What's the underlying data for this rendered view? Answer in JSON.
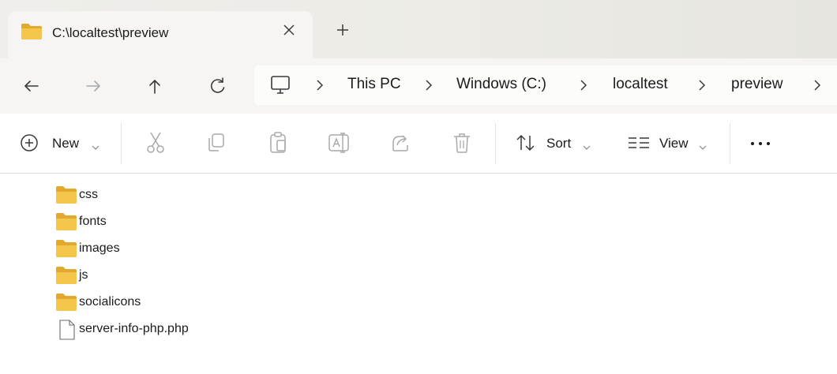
{
  "window": {
    "tab_title": "C:\\localtest\\preview",
    "tab_icon": "folder-icon",
    "close_icon": "close-icon",
    "new_tab_icon": "plus-icon"
  },
  "navigation": {
    "back_icon": "arrow-left-icon",
    "forward_icon": "arrow-right-icon",
    "up_icon": "arrow-up-icon",
    "refresh_icon": "refresh-icon"
  },
  "address_bar": {
    "root_icon": "this-pc-icon",
    "breadcrumbs": [
      "This PC",
      "Windows (C:)",
      "localtest",
      "preview"
    ]
  },
  "toolbar": {
    "new_label": "New",
    "sort_label": "Sort",
    "view_label": "View",
    "icons": [
      "cut-icon",
      "copy-icon",
      "paste-icon",
      "rename-icon",
      "share-icon",
      "delete-icon"
    ],
    "more_icon": "more-icon"
  },
  "files": [
    {
      "name": "css",
      "type": "folder"
    },
    {
      "name": "fonts",
      "type": "folder"
    },
    {
      "name": "images",
      "type": "folder"
    },
    {
      "name": "js",
      "type": "folder"
    },
    {
      "name": "socialicons",
      "type": "folder"
    },
    {
      "name": "server-info-php.php",
      "type": "file"
    }
  ],
  "colors": {
    "folder": "#f4c64b",
    "folder_dark": "#e3a92c",
    "icon_disabled": "#a9a9a9",
    "icon": "#444444"
  }
}
